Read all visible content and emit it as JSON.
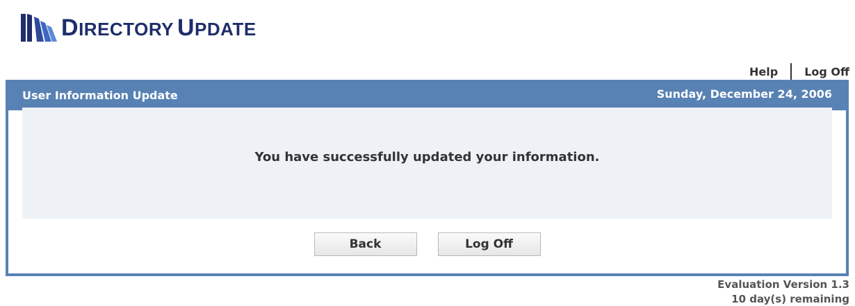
{
  "header": {
    "app_title_first_initial": "D",
    "app_title_first_rest": "IRECTORY",
    "app_title_second_initial": "U",
    "app_title_second_rest": "PDATE",
    "logo_icon": "books-logo-icon",
    "logo_color": "#1e2d6b"
  },
  "toplinks": {
    "help": "Help",
    "logoff": "Log Off"
  },
  "panel": {
    "title": "User Information Update",
    "date": "Sunday, December 24, 2006",
    "message": "You have successfully updated your information.",
    "accent_color": "#5882b4"
  },
  "buttons": {
    "back": "Back",
    "logoff": "Log Off"
  },
  "footer": {
    "version": "Evaluation Version 1.3",
    "remaining": "10 day(s) remaining"
  }
}
